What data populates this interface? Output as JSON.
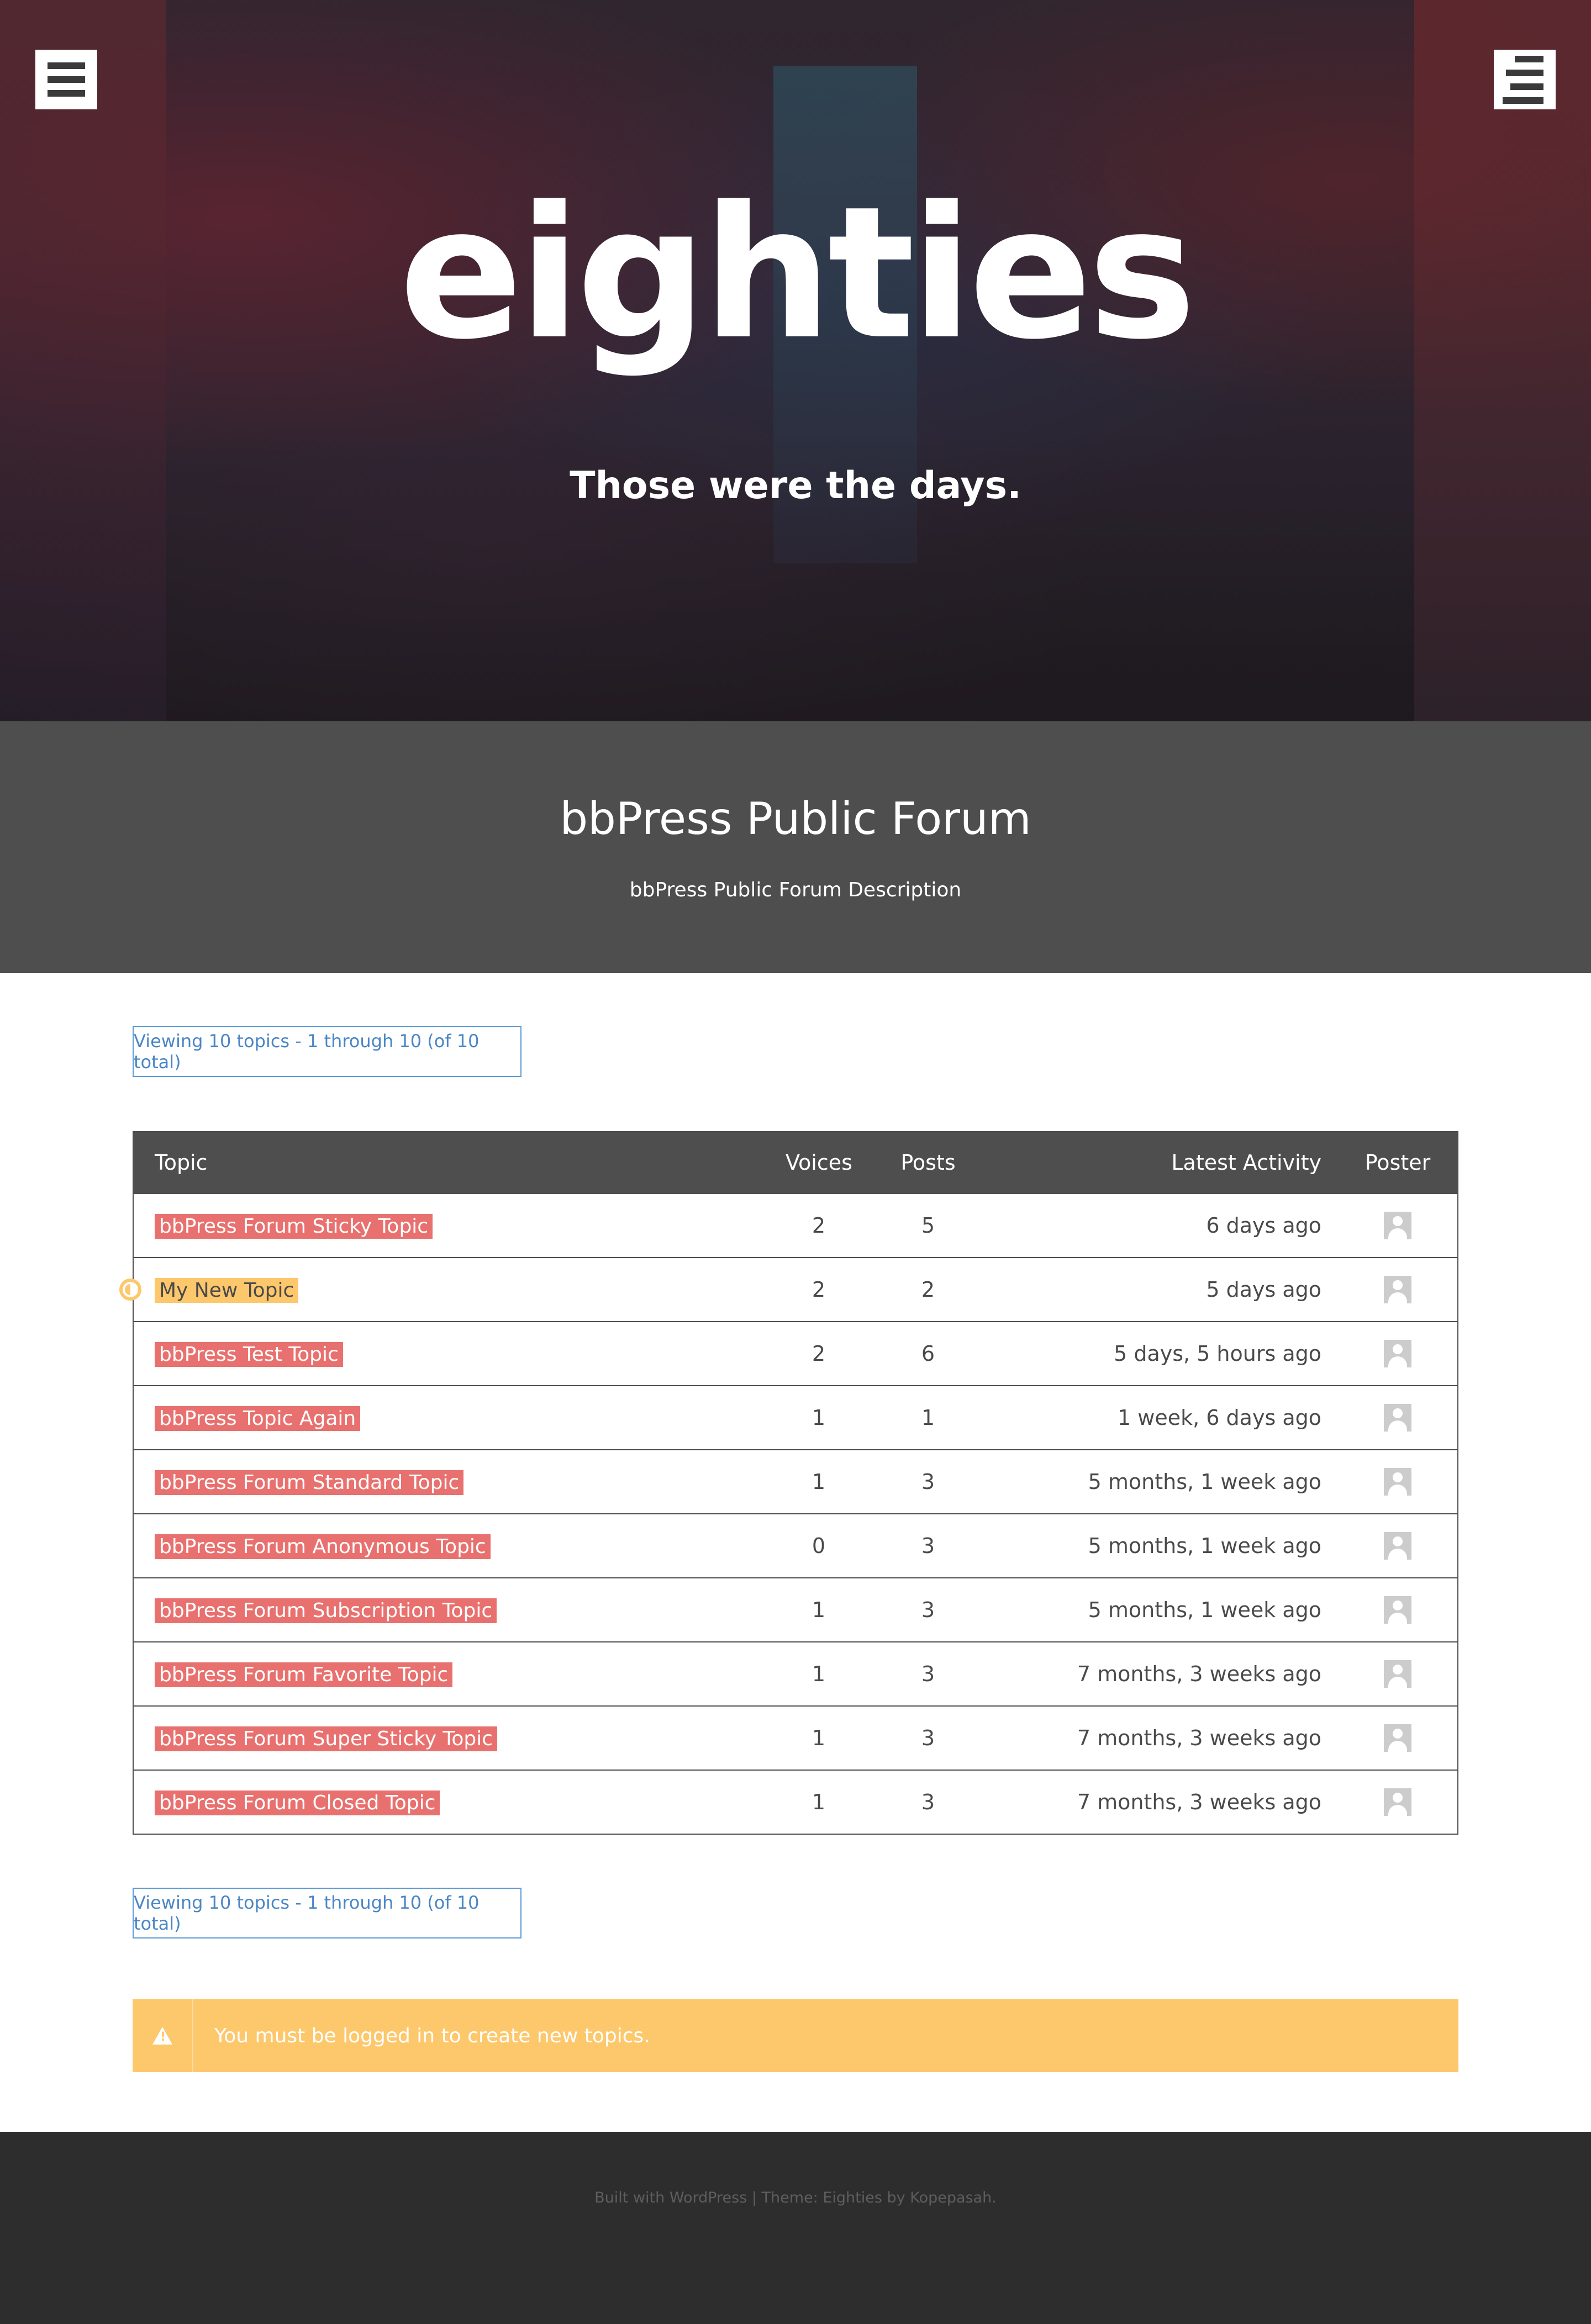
{
  "site": {
    "title": "eighties",
    "tagline": "Those were the days."
  },
  "forum": {
    "title": "bbPress Public Forum",
    "description": "bbPress Public Forum Description"
  },
  "pagination": {
    "top_text": "Viewing 10 topics - 1 through 10 (of 10 total)",
    "bottom_text": "Viewing 10 topics - 1 through 10 (of 10 total)"
  },
  "table": {
    "headers": {
      "topic": "Topic",
      "voices": "Voices",
      "posts": "Posts",
      "latest": "Latest Activity",
      "poster": "Poster"
    },
    "rows": [
      {
        "topic": "bbPress Forum Sticky Topic",
        "voices": "2",
        "posts": "5",
        "latest": "6 days ago"
      },
      {
        "topic": "My New Topic",
        "voices": "2",
        "posts": "2",
        "latest": "5 days ago"
      },
      {
        "topic": "bbPress Test Topic",
        "voices": "2",
        "posts": "6",
        "latest": "5 days, 5 hours ago"
      },
      {
        "topic": "bbPress Topic Again",
        "voices": "1",
        "posts": "1",
        "latest": "1 week, 6 days ago"
      },
      {
        "topic": "bbPress Forum Standard Topic",
        "voices": "1",
        "posts": "3",
        "latest": "5 months, 1 week ago"
      },
      {
        "topic": "bbPress Forum Anonymous Topic",
        "voices": "0",
        "posts": "3",
        "latest": "5 months, 1 week ago"
      },
      {
        "topic": "bbPress Forum Subscription Topic",
        "voices": "1",
        "posts": "3",
        "latest": "5 months, 1 week ago"
      },
      {
        "topic": "bbPress Forum Favorite Topic",
        "voices": "1",
        "posts": "3",
        "latest": "7 months, 3 weeks ago"
      },
      {
        "topic": "bbPress Forum Super Sticky Topic",
        "voices": "1",
        "posts": "3",
        "latest": "7 months, 3 weeks ago"
      },
      {
        "topic": "bbPress Forum Closed Topic",
        "voices": "1",
        "posts": "3",
        "latest": "7 months, 3 weeks ago"
      }
    ]
  },
  "notice": {
    "icon": "warning-icon",
    "text": "You must be logged in to create new topics."
  },
  "footer": {
    "text": "Built with WordPress | Theme: Eighties by Kopepasah."
  },
  "icons": {
    "menu_left": "hamburger-menu-icon",
    "menu_right": "sidebar-menu-icon",
    "poster": "avatar-placeholder-icon",
    "new_topic": "new-topic-indicator-icon"
  },
  "colors": {
    "topic_highlight": "#e8716f",
    "open_topic_highlight": "#fdc76c",
    "header_bg": "#4e4e4e",
    "footer_bg": "#2d2d2d",
    "notice_bg": "#fdc76c",
    "link_blue": "#4a86c5"
  }
}
